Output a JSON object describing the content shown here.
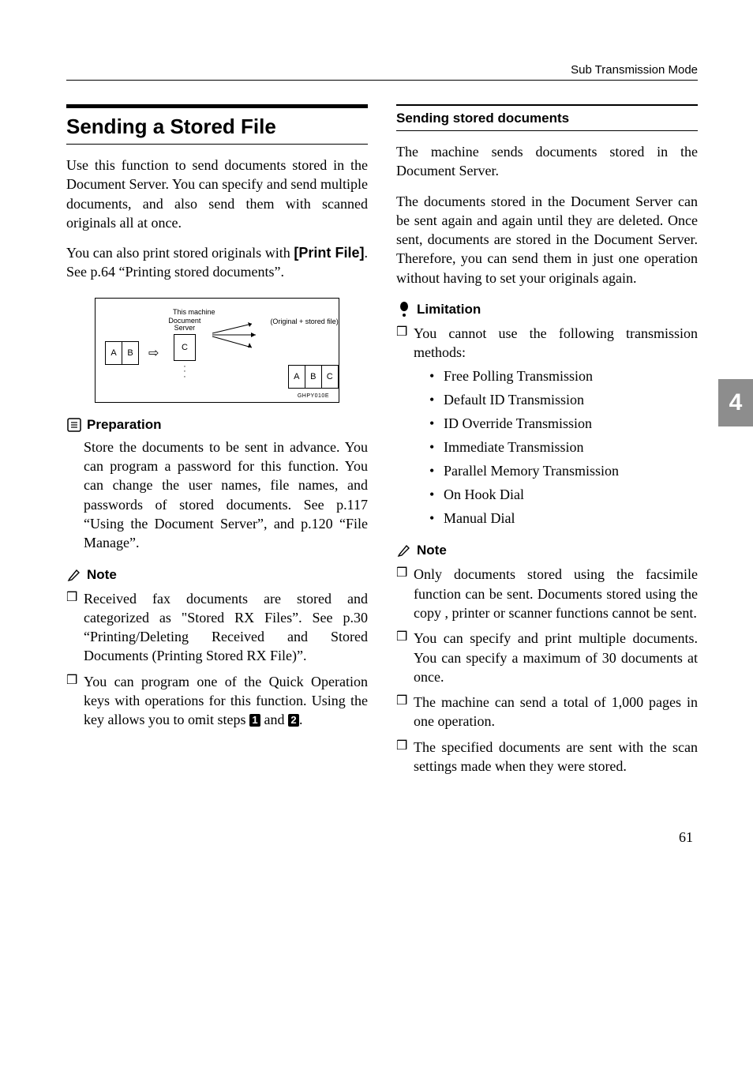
{
  "header": {
    "running_title": "Sub Transmission Mode"
  },
  "side_tab": "4",
  "page_number": "61",
  "left": {
    "title": "Sending a Stored File",
    "intro1": "Use this function to send documents stored in the Document Server. You can specify and send multiple documents, and also send them with scanned originals all at once.",
    "intro2_pre": "You can also print stored originals with ",
    "intro2_bold": "[Print File]",
    "intro2_post": ". See p.64 “Printing stored documents”.",
    "diagram": {
      "this_machine": "This machine",
      "doc_server": "Document\nServer",
      "orig_stored": "(Original + stored file)",
      "a": "A",
      "b": "B",
      "c": "C",
      "caption": "GHPY010E"
    },
    "preparation_heading": "Preparation",
    "preparation_body": "Store the documents to be sent in advance. You can program a password for this function. You can change the user names, file names, and passwords of stored documents. See p.117 “Using the Document Server”, and p.120 “File Manage”.",
    "note_heading": "Note",
    "notes": [
      "Received fax documents are stored and categorized as \"Stored RX Files”. See p.30 “Printing/Deleting Received and Stored Documents (Printing Stored RX File)”."
    ],
    "note2_pre": "You can program one of the Quick Operation keys with operations for this function. Using the key allows you to omit steps ",
    "note2_mid": " and ",
    "note2_post": ".",
    "step1": "1",
    "step2": "2"
  },
  "right": {
    "subheading": "Sending stored documents",
    "p1": "The machine sends documents stored in the Document Server.",
    "p2": "The documents stored in the Document Server can be sent again and again until they are deleted. Once sent, documents are stored in the Document Server. Therefore, you can send them in just one operation without having to set your originals again.",
    "limitation_heading": "Limitation",
    "limitation_intro": "You cannot use the following transmission methods:",
    "limitation_items": [
      "Free Polling Transmission",
      "Default ID Transmission",
      "ID Override Transmission",
      "Immediate Transmission",
      "Parallel Memory Transmission",
      "On Hook Dial",
      "Manual Dial"
    ],
    "note_heading": "Note",
    "notes": [
      "Only documents stored using the facsimile function can be sent. Documents stored using the copy , printer or scanner functions cannot be sent.",
      "You can specify and print multiple documents. You can specify a maximum of 30 documents at once.",
      "The machine can send a total of 1,000 pages in one operation.",
      "The specified documents are sent with the scan settings made when they were stored."
    ]
  }
}
